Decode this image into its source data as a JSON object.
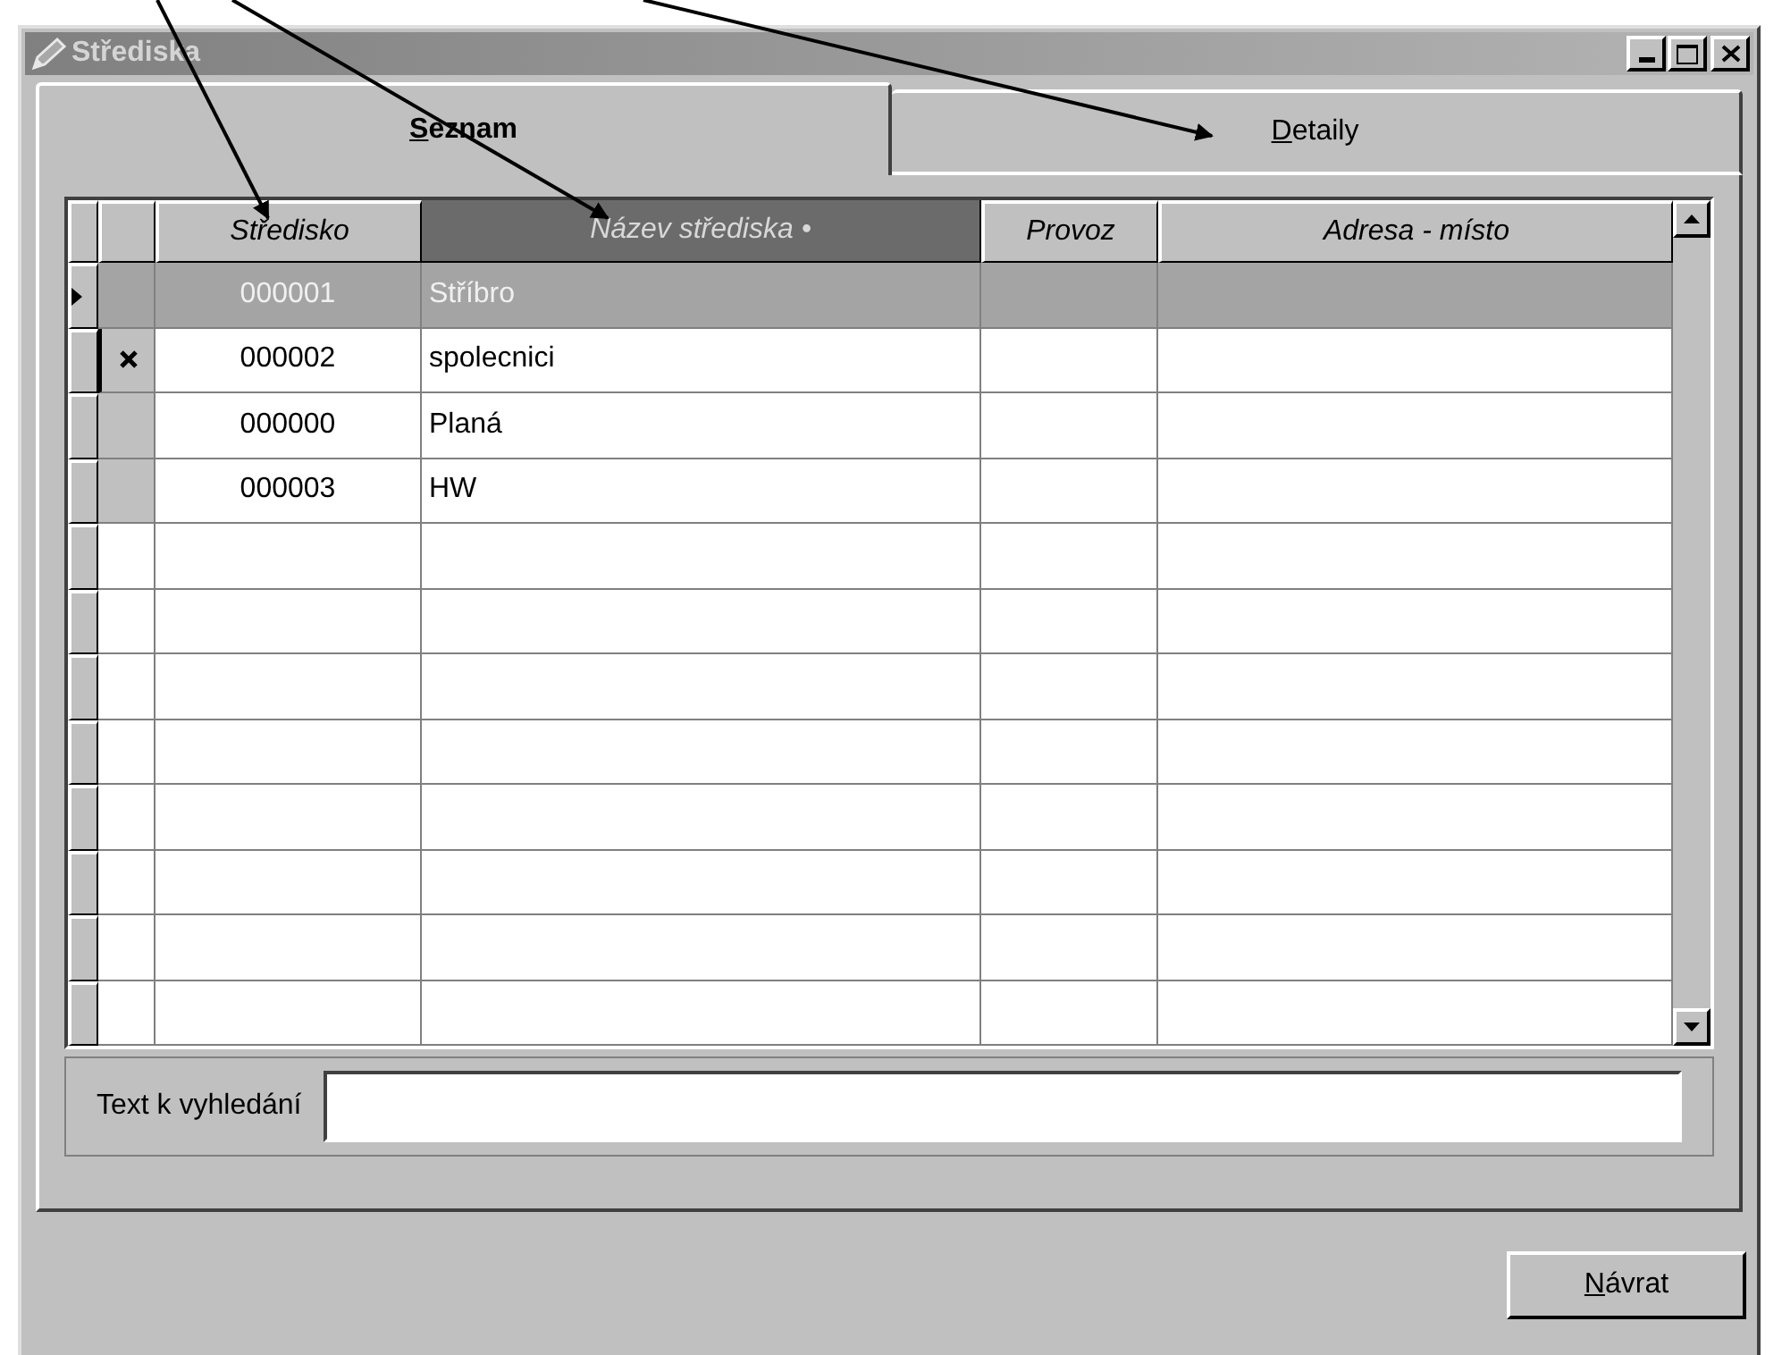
{
  "window": {
    "title": "Střediska"
  },
  "tabs": [
    {
      "label": "Seznam",
      "selected": true
    },
    {
      "label": "Detaily",
      "selected": false
    }
  ],
  "table": {
    "columns": [
      {
        "label": "Středisko",
        "sorted": false
      },
      {
        "label": "Název střediska •",
        "sorted": true
      },
      {
        "label": "Provoz",
        "sorted": false
      },
      {
        "label": "Adresa - místo",
        "sorted": false
      }
    ],
    "rows": [
      {
        "cells": [
          "000001",
          "Stříbro",
          "",
          ""
        ],
        "selected": true,
        "marked": false
      },
      {
        "cells": [
          "000002",
          "spolecnici",
          "",
          ""
        ],
        "selected": false,
        "marked": true
      },
      {
        "cells": [
          "000000",
          "Planá",
          "",
          ""
        ],
        "selected": false,
        "marked": false
      },
      {
        "cells": [
          "000003",
          "HW",
          "",
          ""
        ],
        "selected": false,
        "marked": false
      }
    ]
  },
  "search": {
    "label": "Text k vyhledání"
  },
  "buttons": [
    {
      "label": "Návrat"
    }
  ]
}
